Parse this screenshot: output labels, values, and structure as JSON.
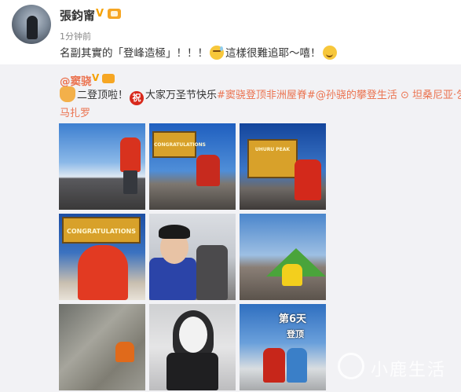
{
  "post": {
    "username": "張鈞甯",
    "verified_mark": "V",
    "timestamp": "1分钟前",
    "text_part1": "名副其實的「登峰造極」！！！",
    "text_part2": "這樣很難追耶～嘻！"
  },
  "repost": {
    "username": "@窦骁",
    "verified_mark": "V",
    "line1_a": "二登顶啦！",
    "line1_b": "大家万圣节快乐",
    "hashtag1": "#窦骁登顶非洲屋脊#",
    "mention": "@孙骁的攀登生活",
    "location_icon": "location-pin-icon",
    "location_a": "坦桑尼亚·乞力",
    "location_b": "马扎罗",
    "zhu_char": "祝"
  },
  "photos": {
    "sign_text_1": "CONGRATULATIONS",
    "sign_text_2": "UHURU PEAK",
    "overlay_9a": "第6天",
    "overlay_9b": "登顶"
  },
  "watermark": {
    "text": "小鹿生活"
  },
  "colors": {
    "link": "#eb7350",
    "badge": "#f6a623",
    "repost_bg": "#f2f2f5"
  }
}
